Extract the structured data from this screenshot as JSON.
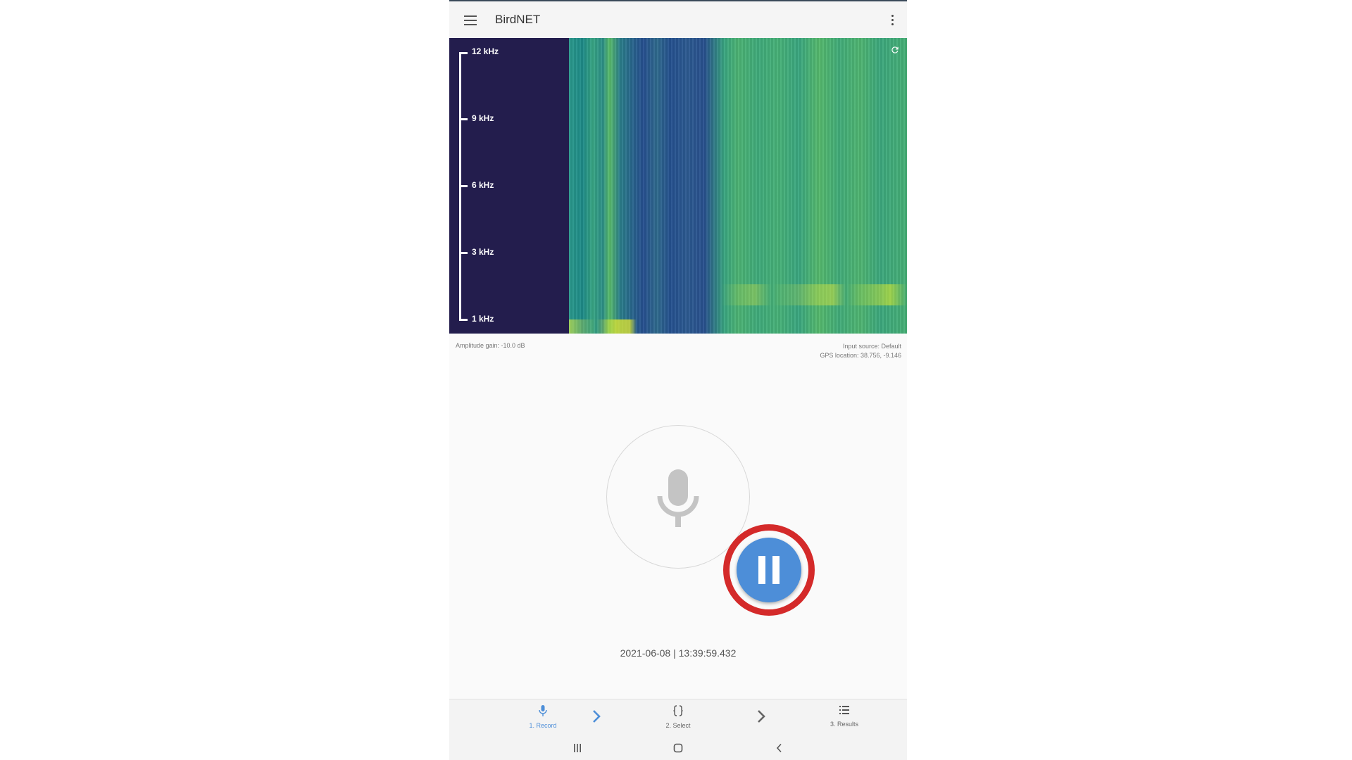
{
  "app": {
    "title": "BirdNET"
  },
  "spectrogram": {
    "axis_labels": [
      "12 kHz",
      "9 kHz",
      "6 kHz",
      "3 kHz",
      "1 kHz"
    ],
    "amplitude_gain": "Amplitude gain: -10.0 dB",
    "input_source": "Input source: Default",
    "gps_location": "GPS location: 38.756, -9.146"
  },
  "recorder": {
    "timestamp": "2021-06-08 | 13:39:59.432"
  },
  "bottom_nav": {
    "items": [
      {
        "label": "1. Record",
        "icon": "mic-icon",
        "active": true
      },
      {
        "label": "2. Select",
        "icon": "braces-icon",
        "active": false
      },
      {
        "label": "3. Results",
        "icon": "list-icon",
        "active": false
      }
    ]
  },
  "colors": {
    "accent": "#4d8ed8",
    "highlight_ring": "#d42a2a",
    "spectrogram_bg": "#231d4d"
  }
}
